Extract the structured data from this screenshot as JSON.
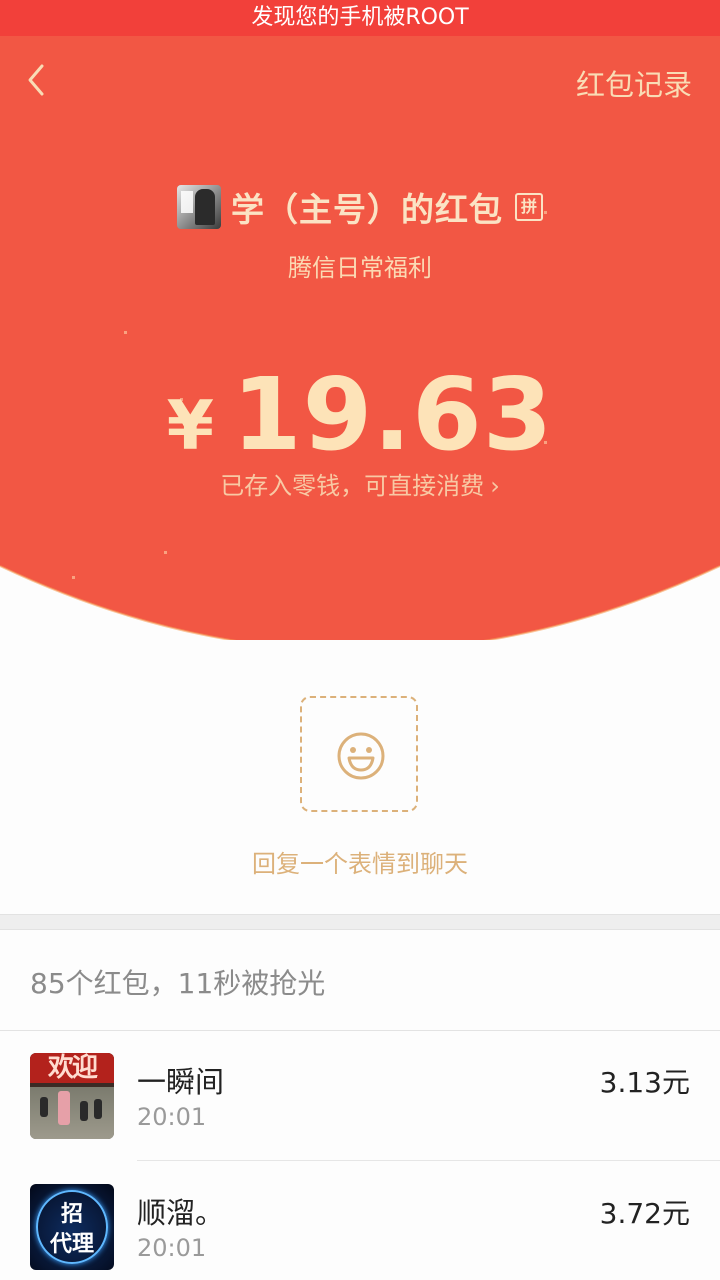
{
  "system_banner": {
    "text": "发现您的手机被ROOT"
  },
  "header": {
    "back_icon": "chevron-left-icon",
    "records_label": "红包记录"
  },
  "packet": {
    "sender_name": "学（主号）的红包",
    "pin_badge": "拼",
    "blessing": "腾信日常福利",
    "currency": "¥",
    "amount": "19.63",
    "stored_note": "已存入零钱，可直接消费",
    "stored_chevron": "›"
  },
  "emoji_reply": {
    "icon": "smile-icon",
    "caption": "回复一个表情到聊天"
  },
  "summary": {
    "text": "85个红包，11秒被抢光"
  },
  "recipients": [
    {
      "name": "一瞬间",
      "time": "20:01",
      "amount": "3.13元",
      "avatar_text": "欢迎"
    },
    {
      "name": "顺溜。",
      "time": "20:01",
      "amount": "3.72元",
      "avatar_text_1": "招",
      "avatar_text_2": "代理"
    }
  ],
  "colors": {
    "banner": "#f2403a",
    "hero": "#f25744",
    "gold": "#fde3b8",
    "emoji_gold": "#dcb17a"
  }
}
